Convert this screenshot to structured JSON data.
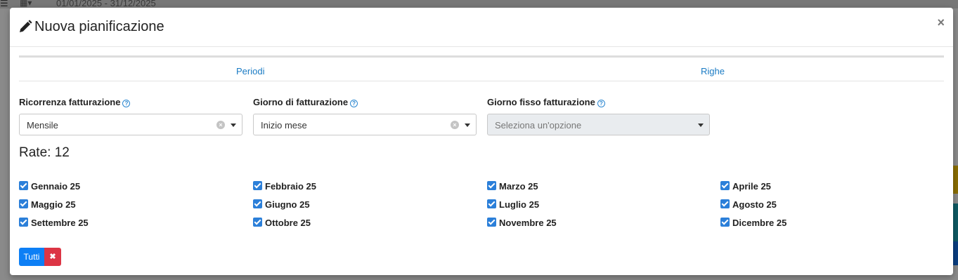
{
  "background": {
    "menu_icon": "bars-icon",
    "calendar_icon": "calendar-icon",
    "date_range": "01/01/2025 - 31/12/2025"
  },
  "modal": {
    "title": "Nuova pianificazione",
    "title_icon": "pencil-icon",
    "close_glyph": "×"
  },
  "tabs": [
    {
      "label": "Periodi"
    },
    {
      "label": "Righe"
    }
  ],
  "fields": {
    "ricorrenza": {
      "label": "Ricorrenza fatturazione",
      "value": "Mensile"
    },
    "giorno": {
      "label": "Giorno di fatturazione",
      "value": "Inizio mese"
    },
    "giorno_fisso": {
      "label": "Giorno fisso fatturazione",
      "placeholder": "Seleziona un'opzione"
    }
  },
  "rate_label": "Rate: 12",
  "months": [
    {
      "label": "Gennaio 25",
      "checked": true
    },
    {
      "label": "Febbraio 25",
      "checked": true
    },
    {
      "label": "Marzo 25",
      "checked": true
    },
    {
      "label": "Aprile 25",
      "checked": true
    },
    {
      "label": "Maggio 25",
      "checked": true
    },
    {
      "label": "Giugno 25",
      "checked": true
    },
    {
      "label": "Luglio 25",
      "checked": true
    },
    {
      "label": "Agosto 25",
      "checked": true
    },
    {
      "label": "Settembre 25",
      "checked": true
    },
    {
      "label": "Ottobre 25",
      "checked": true
    },
    {
      "label": "Novembre 25",
      "checked": true
    },
    {
      "label": "Dicembre 25",
      "checked": true
    }
  ],
  "buttons": {
    "tutti": "Tutti",
    "deselect_glyph": "✖"
  },
  "colors": {
    "primary": "#0d7ff5",
    "danger": "#dc3545",
    "link": "#1a7bc4",
    "checkbox": "#2b7fd9"
  }
}
